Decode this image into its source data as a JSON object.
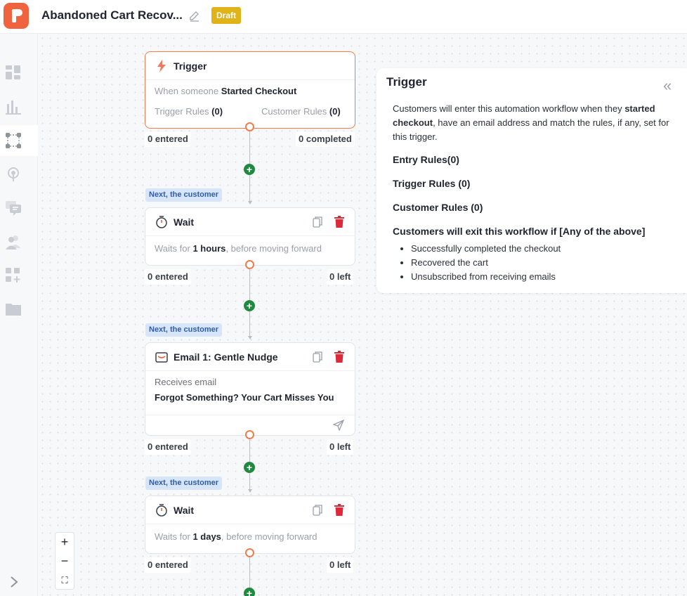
{
  "header": {
    "title": "Abandoned Cart Recov...",
    "status": "Draft"
  },
  "sidebar": {
    "items": [
      {
        "name": "dashboard"
      },
      {
        "name": "analytics"
      },
      {
        "name": "workflows",
        "active": true
      },
      {
        "name": "broadcast"
      },
      {
        "name": "messages"
      },
      {
        "name": "customers"
      },
      {
        "name": "integrations"
      },
      {
        "name": "files"
      }
    ]
  },
  "trigger_node": {
    "title": "Trigger",
    "line_prefix": "When someone",
    "line_event": "Started Checkout",
    "trigger_rules_label": "Trigger Rules",
    "trigger_rules_count": "(0)",
    "customer_rules_label": "Customer Rules",
    "customer_rules_count": "(0)",
    "entered": "0 entered",
    "completed": "0 completed"
  },
  "next_label": "Next, the customer",
  "wait1": {
    "title": "Wait",
    "prefix": "Waits for",
    "amount": "1 hours",
    "suffix": ", before moving forward",
    "entered": "0 entered",
    "left": "0 left"
  },
  "email1": {
    "title": "Email 1: Gentle Nudge",
    "receives": "Receives email",
    "subject": "Forgot Something? Your Cart Misses You",
    "entered": "0 entered",
    "left": "0 left"
  },
  "wait2": {
    "title": "Wait",
    "prefix": "Waits for",
    "amount": "1 days",
    "suffix": ", before moving forward",
    "entered": "0 entered",
    "left": "0 left"
  },
  "zoom": {
    "in": "+",
    "out": "−",
    "fit": "⛶"
  },
  "panel": {
    "title": "Trigger",
    "desc_before": "Customers will enter this automation workflow when they ",
    "desc_bold": "started checkout",
    "desc_after": ", have an email address and match the rules, if any, set for this trigger.",
    "entry_rules": "Entry Rules(0)",
    "trigger_rules": "Trigger Rules  (0)",
    "customer_rules": "Customer Rules  (0)",
    "exit_heading": "Customers will exit this workflow if [Any of the above]",
    "exit_items": [
      "Successfully completed the checkout",
      "Recovered the cart",
      "Unsubscribed from receiving emails"
    ]
  },
  "colors": {
    "brand": "#f0633f",
    "draft": "#e0b31a",
    "add": "#1f8a3f",
    "delete": "#d92b3a",
    "next_tag": "#d7e5fb"
  }
}
